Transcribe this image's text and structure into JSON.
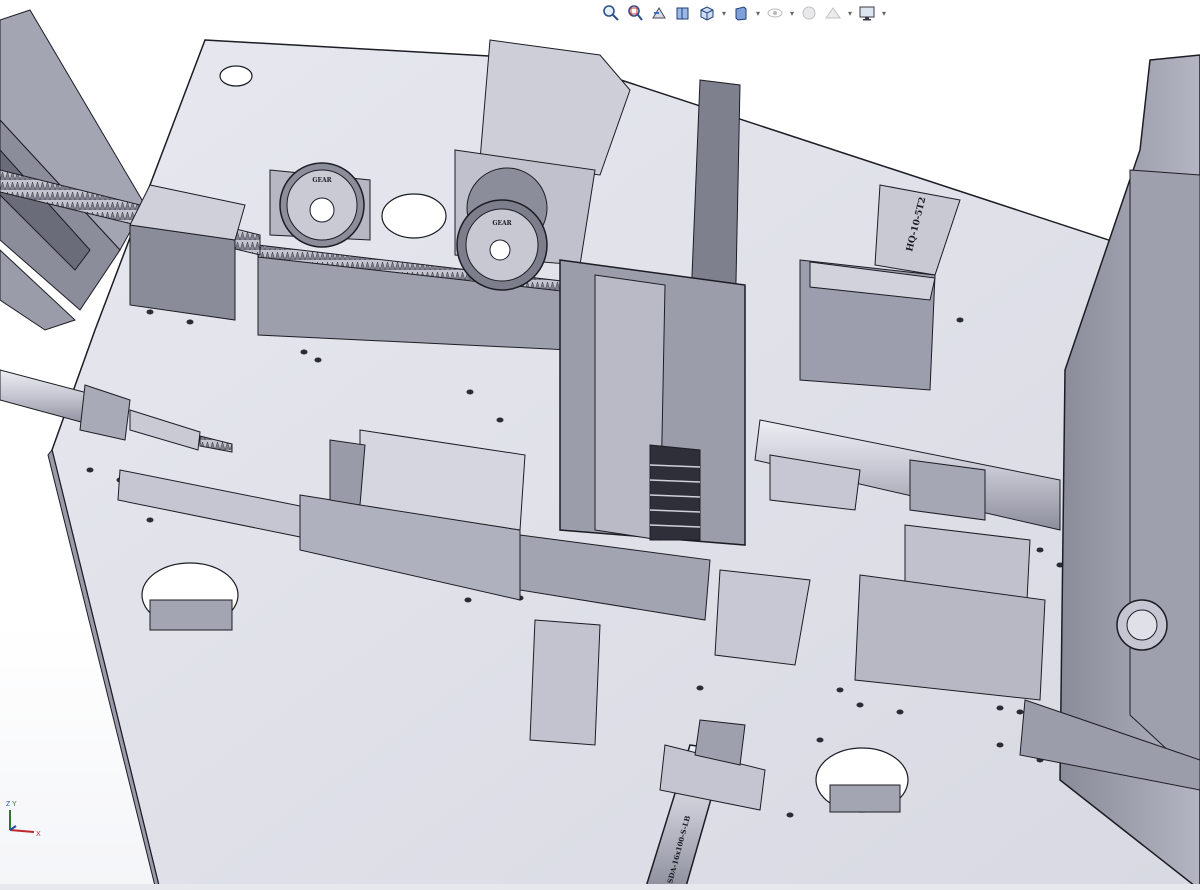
{
  "toolbar": {
    "buttons": [
      {
        "icon": "zoom-to-fit-icon",
        "label": "Zoom to Fit"
      },
      {
        "icon": "zoom-to-area-icon",
        "label": "Zoom to Area"
      },
      {
        "icon": "previous-view-icon",
        "label": "Previous View"
      },
      {
        "icon": "section-view-icon",
        "label": "Section View"
      },
      {
        "icon": "view-orientation-icon",
        "label": "View Orientation"
      },
      {
        "icon": "display-style-icon",
        "label": "Display Style"
      },
      {
        "icon": "hide-show-items-icon",
        "label": "Hide/Show Items"
      },
      {
        "icon": "edit-appearance-icon",
        "label": "Edit Appearance"
      },
      {
        "icon": "apply-scene-icon",
        "label": "Apply Scene"
      },
      {
        "icon": "view-settings-icon",
        "label": "View Settings"
      }
    ]
  },
  "model": {
    "labels": {
      "slide_table": "HQ-10-5T2",
      "cylinder": "SDA-16x100-S-LB",
      "gear_left": "GEAR",
      "gear_right": "GEAR"
    }
  },
  "triad": {
    "y": "Y",
    "z": "Z",
    "x": "X"
  },
  "colors": {
    "metal_light": "#dcdde6",
    "metal_mid": "#b3b4c1",
    "metal_dark": "#7e7f8f",
    "edge": "#1c1d24",
    "background": "#ffffff"
  }
}
